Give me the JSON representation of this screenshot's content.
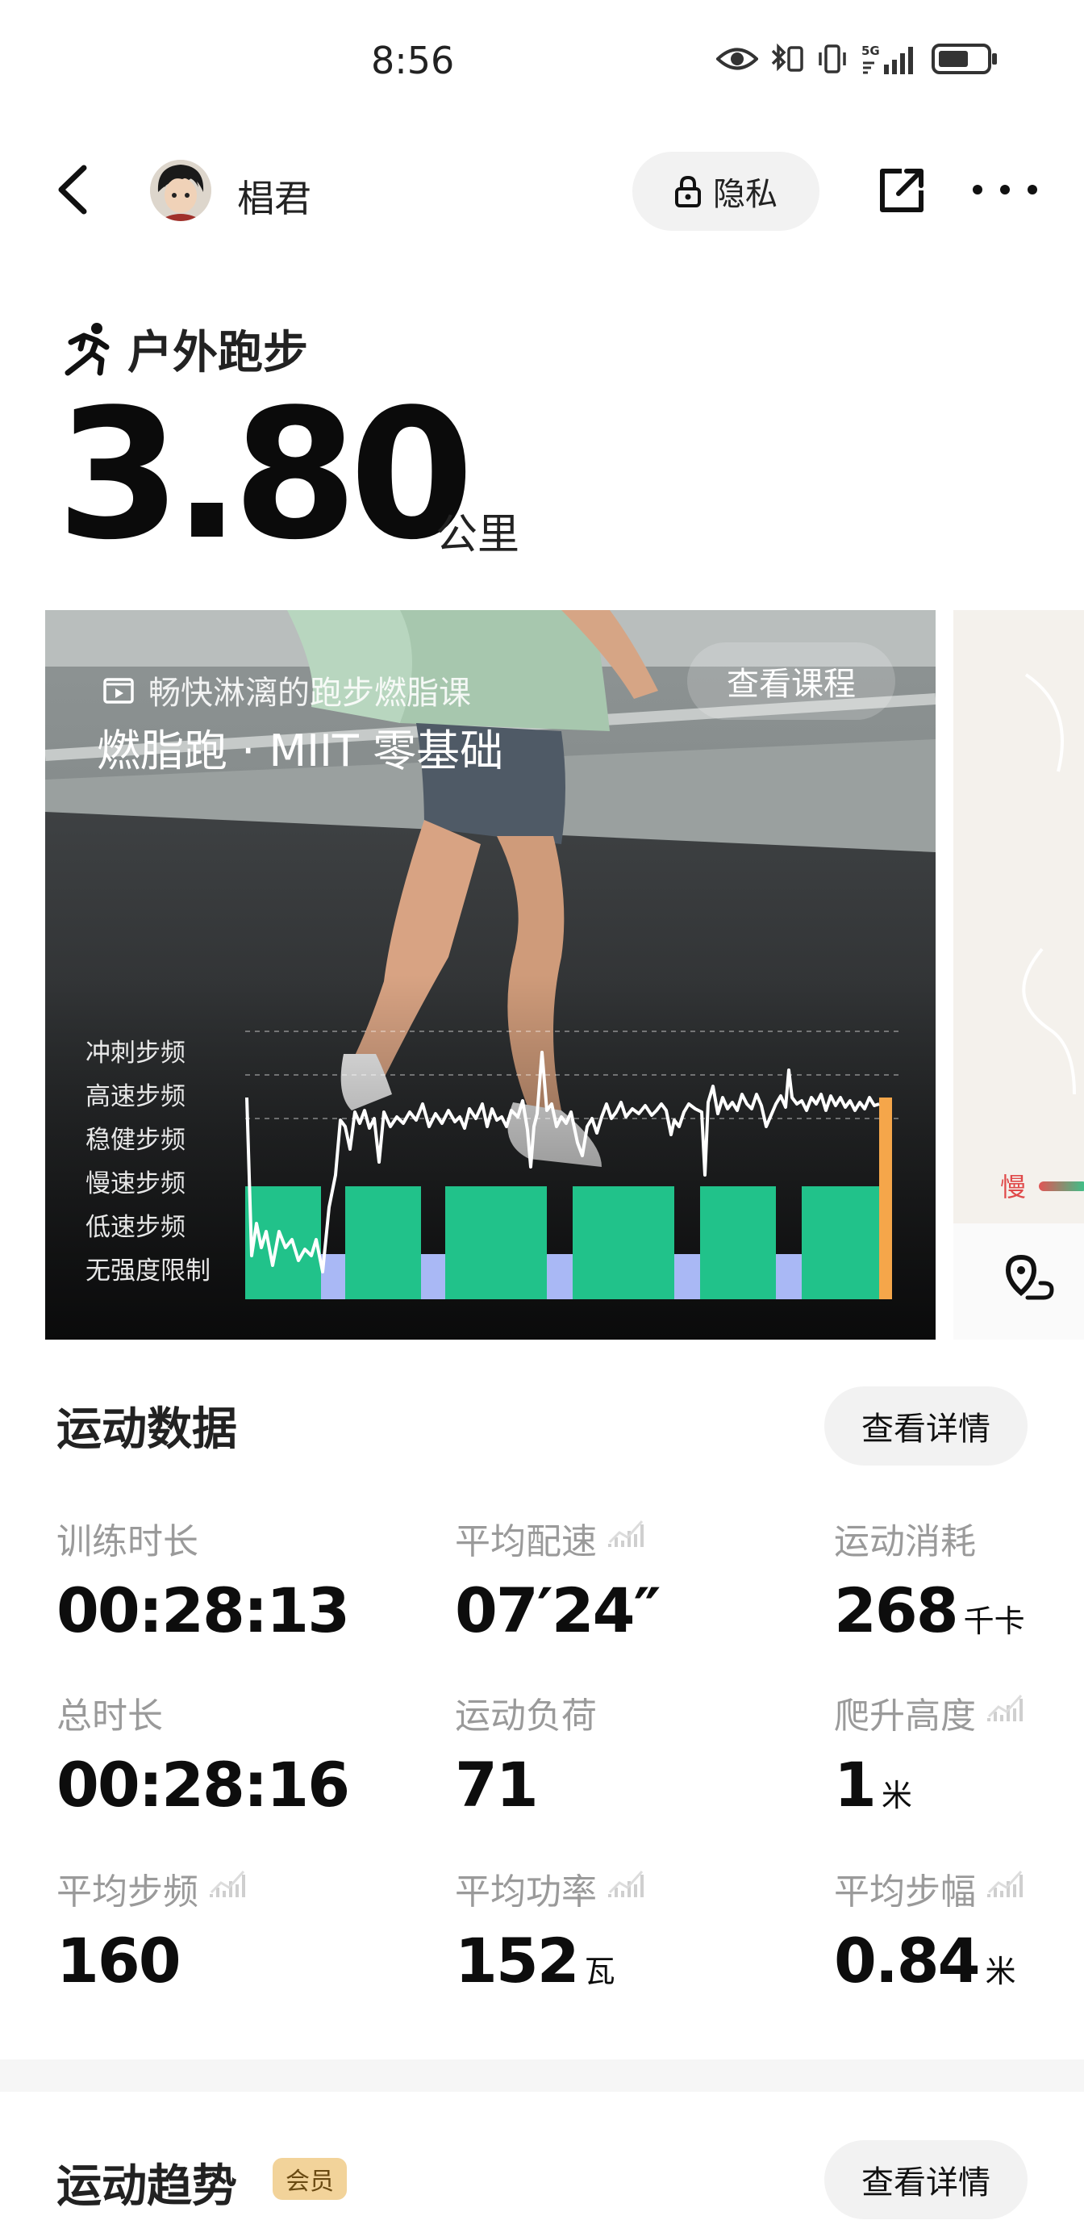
{
  "status_bar": {
    "time": "8:56",
    "network": "5G"
  },
  "header": {
    "username": "椙君",
    "privacy_label": "隐私"
  },
  "workout": {
    "sport_name": "户外跑步",
    "distance": "3.80",
    "distance_unit": "公里"
  },
  "course_card": {
    "caption": "畅快淋漓的跑步燃脂课",
    "title": "燃脂跑 · MIIT 零基础",
    "view_course_label": "查看课程",
    "cadence_levels": [
      "冲刺步频",
      "高速步频",
      "稳健步频",
      "慢速步频",
      "低速步频",
      "无强度限制"
    ]
  },
  "map": {
    "slow_label": "慢"
  },
  "sport_data": {
    "title": "运动数据",
    "detail_label": "查看详情",
    "metrics": [
      {
        "label": "训练时长",
        "value": "00:28:13",
        "unit": "",
        "has_chart_icon": false
      },
      {
        "label": "平均配速",
        "value": "07′24″",
        "unit": "",
        "has_chart_icon": true
      },
      {
        "label": "运动消耗",
        "value": "268",
        "unit": "千卡",
        "has_chart_icon": false
      },
      {
        "label": "总时长",
        "value": "00:28:16",
        "unit": "",
        "has_chart_icon": false
      },
      {
        "label": "运动负荷",
        "value": "71",
        "unit": "",
        "has_chart_icon": false
      },
      {
        "label": "爬升高度",
        "value": "1",
        "unit": "米",
        "has_chart_icon": true
      },
      {
        "label": "平均步频",
        "value": "160",
        "unit": "",
        "has_chart_icon": true
      },
      {
        "label": "平均功率",
        "value": "152",
        "unit": "瓦",
        "has_chart_icon": true
      },
      {
        "label": "平均步幅",
        "value": "0.84",
        "unit": "米",
        "has_chart_icon": true
      }
    ]
  },
  "sport_trend": {
    "title": "运动趋势",
    "badge": "会员",
    "detail_label": "查看详情"
  },
  "colors": {
    "block_green": "#21c28a",
    "block_blue": "#a9b8f5",
    "accent_orange": "#f5a64a"
  }
}
